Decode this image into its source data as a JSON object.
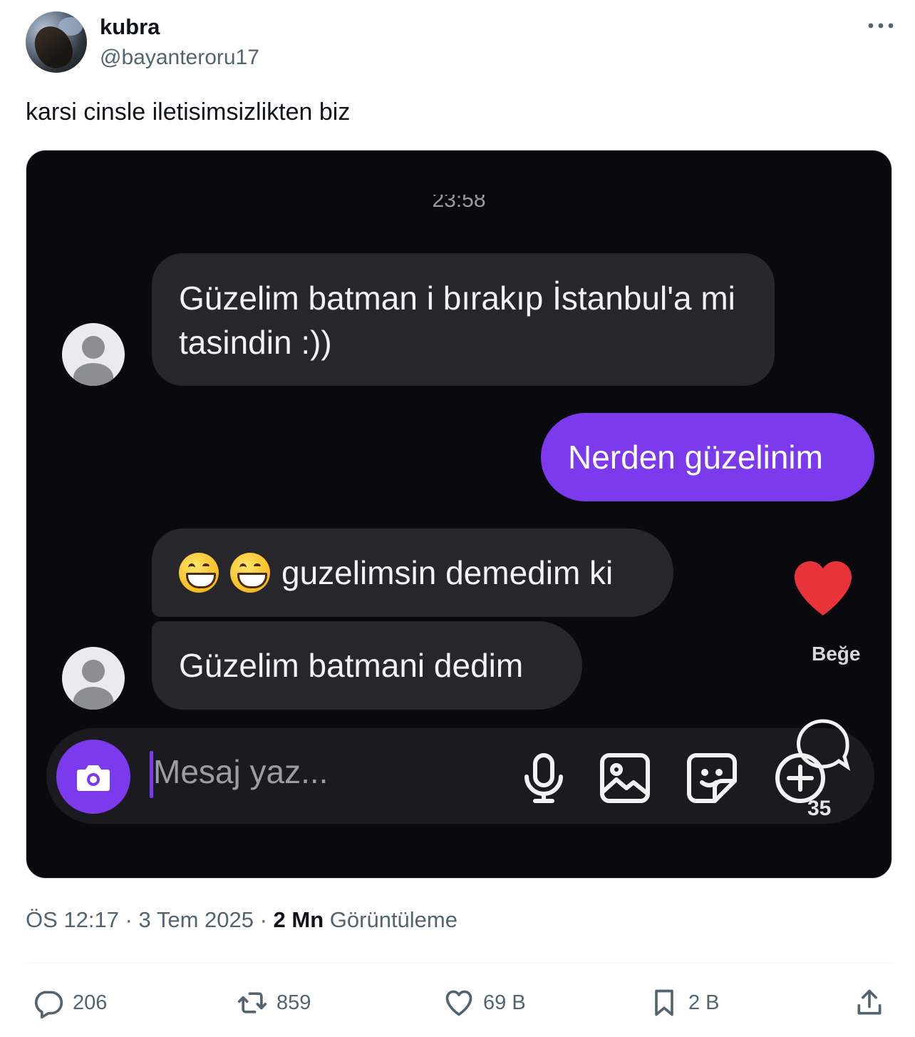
{
  "author": {
    "display_name": "kubra",
    "handle": "@bayanteroru17"
  },
  "tweet": {
    "text": "karsi cinsle iletisimsizlikten biz"
  },
  "chat": {
    "timestamp": "23:58",
    "messages": [
      {
        "text": "Güzelim batman i bırakıp İstanbul'a mi tasindin :))"
      },
      {
        "text": "Nerden güzelinim"
      },
      {
        "text": "guzelimsin demedim ki"
      },
      {
        "text": "Güzelim batmani dedim"
      }
    ],
    "like_label": "Beğe",
    "composer_placeholder": "Mesaj yaz...",
    "overlay_count": "35",
    "accent_color": "#7c3aed"
  },
  "meta": {
    "time": "ÖS 12:17",
    "sep1": " · ",
    "date": "3 Tem 2025",
    "sep2": " · ",
    "views_count": "2 Mn",
    "views_label": " Görüntüleme"
  },
  "actions": {
    "replies": "206",
    "reposts": "859",
    "likes": "69 B",
    "bookmarks": "2 B"
  },
  "icons": [
    "more-icon",
    "reply-icon",
    "repost-icon",
    "like-icon",
    "bookmark-icon",
    "share-icon",
    "camera-icon",
    "mic-icon",
    "gallery-icon",
    "sticker-icon",
    "plus-icon",
    "heart-icon",
    "comment-bubble-icon"
  ]
}
